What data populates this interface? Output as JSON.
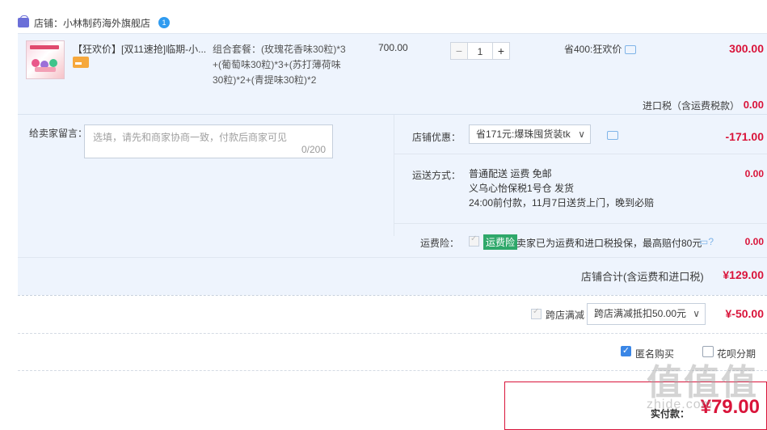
{
  "shop": {
    "label": "店铺：",
    "name": "小林制药海外旗舰店",
    "badge": "1"
  },
  "item": {
    "title": "【狂欢价】[双11速抢]临期-小...",
    "sku_lines": [
      "组合套餐：(玫瑰花香味30粒)*3",
      "+(葡萄味30粒)*3+(苏打薄荷味",
      "30粒)*2+(青提味30粒)*2"
    ],
    "price": "700.00",
    "quantity": "1",
    "minus": "−",
    "plus": "+",
    "saving": "省400:狂欢价",
    "total": "300.00"
  },
  "import_tax": {
    "label": "进口税（含运费税款）",
    "value": "0.00"
  },
  "message": {
    "label": "给卖家留言：",
    "placeholder": "选填，请先和商家协商一致，付款后商家可见",
    "count": "0/200"
  },
  "store_discount": {
    "label": "店铺优惠：",
    "selected": "省171元:爆珠囤货装tk",
    "arrow": "∨",
    "value": "-171.00"
  },
  "shipping": {
    "label": "运送方式：",
    "lines": [
      "普通配送 运费 免邮",
      "义乌心怡保税1号仓   发货",
      "24:00前付款，11月7日送货上门，晚到必赔"
    ],
    "value": "0.00"
  },
  "insurance": {
    "label": "运费险：",
    "tag": "运费险",
    "text": "卖家已为运费和进口税投保，最高赔付80元",
    "icons": "▭?",
    "value": "0.00"
  },
  "store_total": {
    "label": "店铺合计(含运费和进口税)",
    "value": "¥129.00"
  },
  "cross_store": {
    "label": "跨店满减",
    "selected": "跨店满减抵扣50.00元",
    "arrow": "∨",
    "value": "¥-50.00"
  },
  "anonymous": {
    "label": "匿名购买",
    "check": "✓"
  },
  "huabei": {
    "label": "花呗分期"
  },
  "payment": {
    "label": "实付款：",
    "value": "¥79.00"
  },
  "watermark": {
    "main": "值值值",
    "sub": "zhide.com"
  }
}
